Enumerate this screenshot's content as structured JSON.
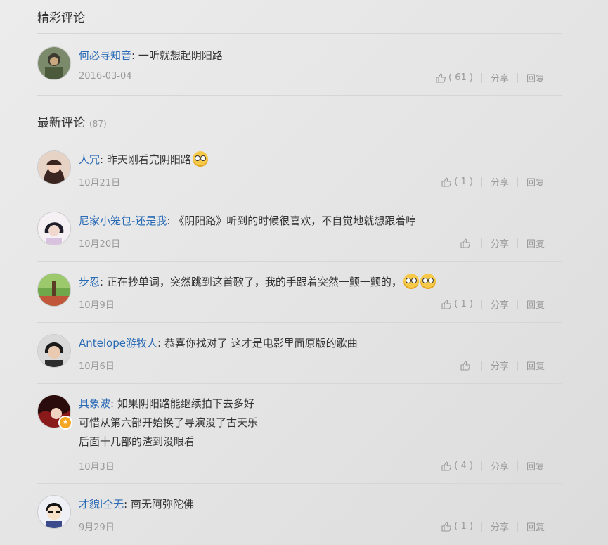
{
  "sections": {
    "featured_title": "精彩评论",
    "latest_title": "最新评论",
    "latest_count": "(87)"
  },
  "labels": {
    "share": "分享",
    "reply": "回复"
  },
  "featured": [
    {
      "user": "何必寻知音",
      "sep": ": ",
      "lines": [
        "一听就想起阴阳路"
      ],
      "emoji_count": 0,
      "time": "2016-03-04",
      "likes": "( 61 )"
    }
  ],
  "latest": [
    {
      "user": "人冗",
      "sep": ": ",
      "lines": [
        "昨天刚看完阴阳路"
      ],
      "emoji_count": 1,
      "time": "10月21日",
      "likes": "( 1 )"
    },
    {
      "user": "尼家小笼包-还是我",
      "sep": ": ",
      "lines": [
        "《阴阳路》听到的时候很喜欢，不自觉地就想跟着哼"
      ],
      "emoji_count": 0,
      "time": "10月20日",
      "likes": ""
    },
    {
      "user": "步忍",
      "sep": ": ",
      "lines": [
        "正在抄单词，突然跳到这首歌了，我的手跟着突然一颤一颤的，"
      ],
      "emoji_count": 2,
      "time": "10月9日",
      "likes": "( 1 )"
    },
    {
      "user": "Antelope游牧人",
      "sep": ": ",
      "lines": [
        "恭喜你找对了 这才是电影里面原版的歌曲"
      ],
      "emoji_count": 0,
      "time": "10月6日",
      "likes": ""
    },
    {
      "user": "具象波",
      "sep": ": ",
      "lines": [
        "如果阴阳路能继续拍下去多好",
        "可惜从第六部开始换了导演没了古天乐",
        "后面十几部的渣到没眼看"
      ],
      "emoji_count": 0,
      "time": "10月3日",
      "likes": "( 4 )"
    },
    {
      "user": "才貌l仝无",
      "sep": ": ",
      "lines": [
        "南无阿弥陀佛"
      ],
      "emoji_count": 0,
      "time": "9月29日",
      "likes": "( 1 )"
    }
  ],
  "avatars": [
    "avatar-featured-1",
    "avatar-1",
    "avatar-2",
    "avatar-3",
    "avatar-4",
    "avatar-5",
    "avatar-6"
  ],
  "colors": {
    "username": "#2a6bb5",
    "meta": "#999999",
    "divider": "#d6d6d6",
    "badge": "#f5a623"
  }
}
